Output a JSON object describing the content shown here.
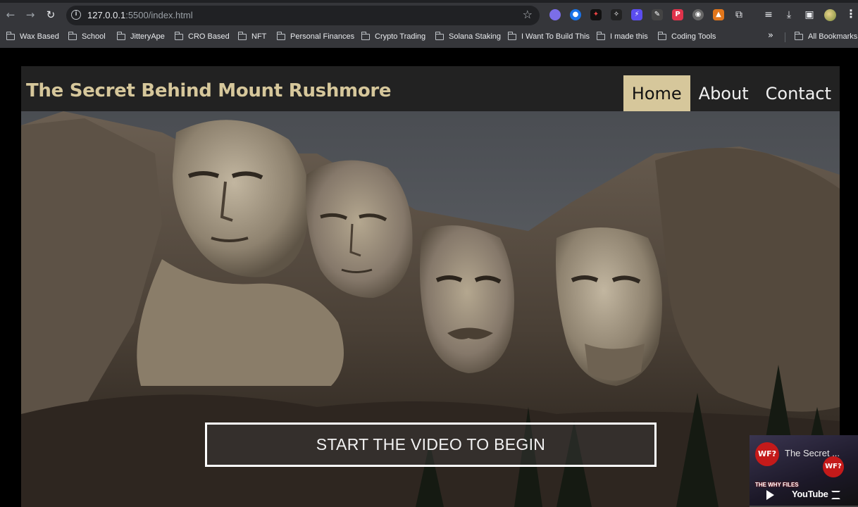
{
  "browser": {
    "url_host": "127.0.0.1",
    "url_rest": ":5500/index.html",
    "nav": {
      "back_icon": "arrow-left-icon",
      "forward_icon": "arrow-right-icon",
      "reload_icon": "reload-icon"
    },
    "bookmarks": [
      {
        "label": "Wax Based"
      },
      {
        "label": "School"
      },
      {
        "label": "JitteryApe"
      },
      {
        "label": "CRO Based"
      },
      {
        "label": "NFT"
      },
      {
        "label": "Personal Finances"
      },
      {
        "label": "Crypto Trading"
      },
      {
        "label": "Solana Staking"
      },
      {
        "label": "I Want To Build This"
      },
      {
        "label": "I made this"
      },
      {
        "label": "Coding Tools"
      }
    ],
    "more_bookmarks": "»",
    "all_bookmarks": "All Bookmarks"
  },
  "site": {
    "title": "The Secret Behind Mount Rushmore",
    "nav": [
      {
        "label": "Home",
        "current": true
      },
      {
        "label": "About",
        "current": false
      },
      {
        "label": "Contact",
        "current": false
      }
    ],
    "cta": "START THE VIDEO TO BEGIN",
    "colors": {
      "accent": "#d6c79b",
      "header_bg": "#222222"
    }
  },
  "mini_player": {
    "badge": "WF?",
    "title": "The Secret ...",
    "caption": "THE WHY FILES",
    "brand": "YouTube"
  }
}
